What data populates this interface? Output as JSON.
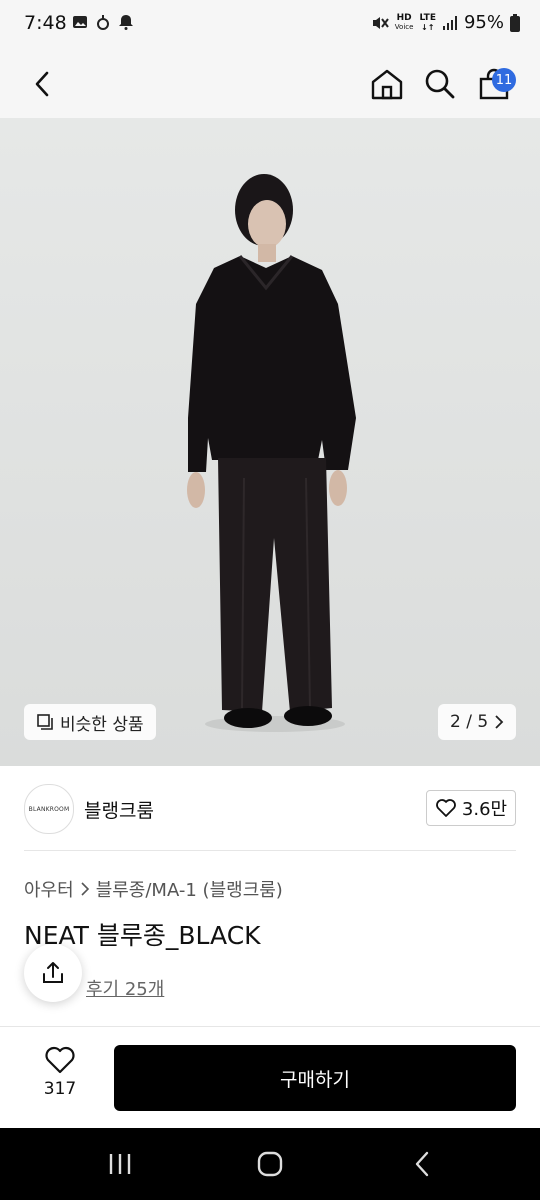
{
  "status_bar": {
    "time": "7:48",
    "left_icons": [
      "image-icon",
      "notification-dot-icon",
      "bell-icon"
    ],
    "hd_label": "HD",
    "hd_sub": "Voice",
    "lte_label": "LTE",
    "battery": "95%"
  },
  "top_bar": {
    "cart_count": "11",
    "icons": [
      "back-chevron-icon",
      "home-icon",
      "search-icon",
      "shopping-bag-icon"
    ]
  },
  "hero": {
    "similar_label": "비슷한 상품",
    "page_indicator": "2 / 5",
    "background": "#e3e5e4"
  },
  "brand": {
    "logo_text": "BLANKROOM",
    "name": "블랭크룸",
    "likes": "3.6만"
  },
  "product": {
    "breadcrumb": [
      "아우터",
      "블루종/MA-1 (블랭크룸)"
    ],
    "title": "NEAT 블루종_BLACK",
    "reviews": "후기 25개"
  },
  "bottom": {
    "wish_count": "317",
    "buy_label": "구매하기"
  },
  "colors": {
    "badge": "#2f6be0",
    "buy_button": "#000000",
    "status_bg": "#f6f6f6"
  }
}
